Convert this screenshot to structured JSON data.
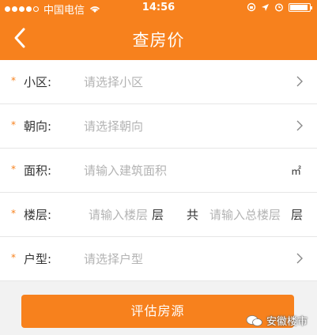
{
  "status": {
    "carrier": "中国电信",
    "time": "14:56"
  },
  "nav": {
    "title": "查房价"
  },
  "rows": [
    {
      "label": "小区:",
      "placeholder": "请选择小区"
    },
    {
      "label": "朝向:",
      "placeholder": "请选择朝向"
    },
    {
      "label": "面积:",
      "placeholder": "请输入建筑面积",
      "unit": "㎡"
    },
    {
      "label": "楼层:",
      "placeholder": "请输入楼层",
      "unit1": "层",
      "middle": "共",
      "placeholder2": "请输入总楼层",
      "unit2": "层"
    },
    {
      "label": "户型:",
      "placeholder": "请选择户型"
    }
  ],
  "required_mark": "*",
  "submit_label": "评估房源",
  "watermark": "安徽楼市",
  "colors": {
    "brand": "#f7811d"
  }
}
